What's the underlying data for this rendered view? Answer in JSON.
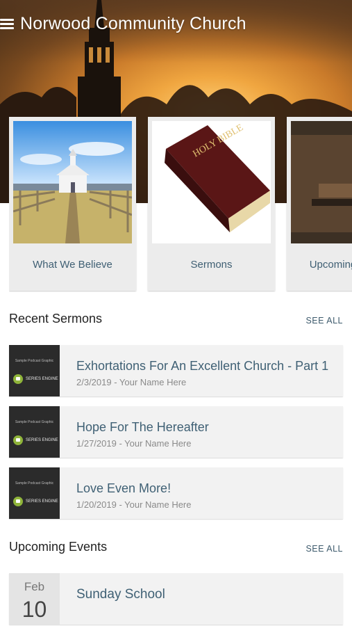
{
  "header": {
    "title": "Norwood Community Church",
    "menu_icon": "hamburger-menu-icon"
  },
  "cards": [
    {
      "label": "What We Believe",
      "image": "country-church-photo"
    },
    {
      "label": "Sermons",
      "image": "holy-bible-photo",
      "book_text": "HOLY BIBLE"
    },
    {
      "label": "Upcoming Events",
      "image": "old-pews-photo"
    }
  ],
  "recent_sermons": {
    "heading": "Recent Sermons",
    "see_all": "SEE ALL",
    "art_small": "Sample Podcast Graphic",
    "art_brand": "SERIES ENGINE",
    "items": [
      {
        "title": "Exhortations For An Excellent Church - Part 1",
        "meta": "2/3/2019 - Your Name Here"
      },
      {
        "title": "Hope For The Hereafter",
        "meta": "1/27/2019 - Your Name Here"
      },
      {
        "title": "Love Even More!",
        "meta": "1/20/2019 - Your Name Here"
      }
    ]
  },
  "upcoming_events": {
    "heading": "Upcoming Events",
    "see_all": "SEE ALL",
    "items": [
      {
        "month": "Feb",
        "day": "10",
        "title": "Sunday School"
      }
    ]
  },
  "colors": {
    "accent_text": "#3f6074",
    "card_bg": "#ececec",
    "row_bg": "#f2f2f2",
    "series_badge": "#8fb43a"
  }
}
